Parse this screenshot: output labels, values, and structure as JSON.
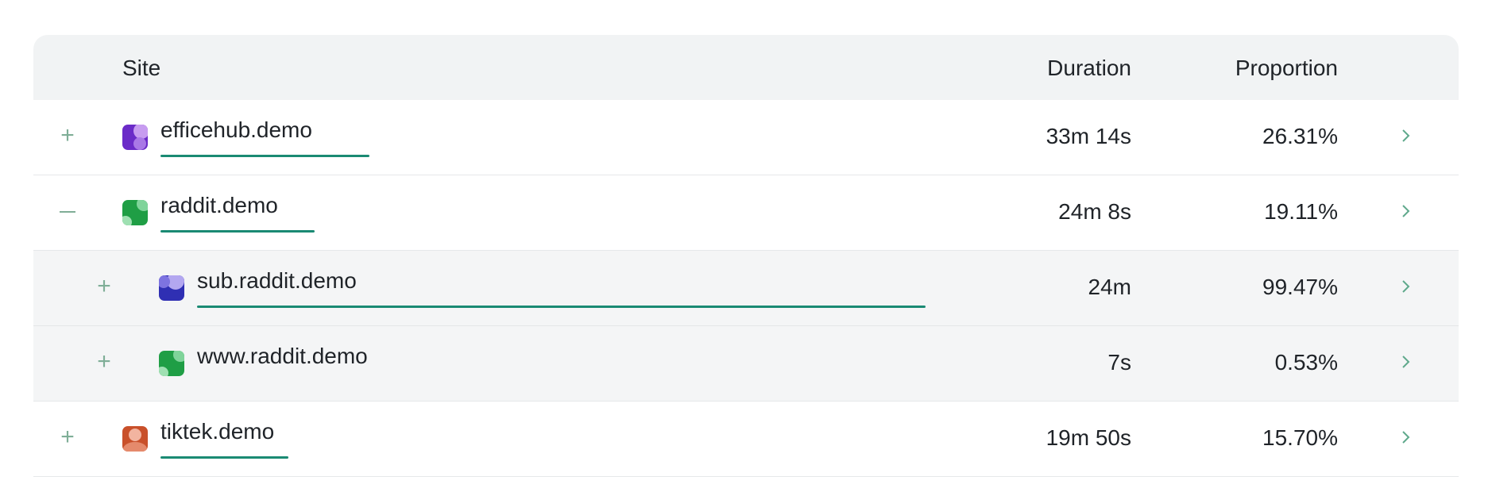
{
  "header": {
    "site": "Site",
    "duration": "Duration",
    "proportion": "Proportion"
  },
  "rows": [
    {
      "site": "efficehub.demo",
      "duration": "33m 14s",
      "proportion": "26.31%",
      "bar_fraction": 0.2631,
      "expanded": false,
      "icon": "efficehub-favicon",
      "icon_colors": [
        "#6b2bc8",
        "#c79cf0"
      ]
    },
    {
      "site": "raddit.demo",
      "duration": "24m 8s",
      "proportion": "19.11%",
      "bar_fraction": 0.1911,
      "expanded": true,
      "icon": "raddit-favicon",
      "icon_colors": [
        "#1f9e45",
        "#7fd49a"
      ]
    },
    {
      "site": "sub.raddit.demo",
      "duration": "24m",
      "proportion": "99.47%",
      "bar_fraction": 0.9947,
      "expanded": false,
      "icon": "sub-raddit-favicon",
      "icon_colors": [
        "#2f2fb3",
        "#b3a7f0"
      ]
    },
    {
      "site": "www.raddit.demo",
      "duration": "7s",
      "proportion": "0.53%",
      "bar_fraction": 0.0053,
      "expanded": false,
      "icon": "www-raddit-favicon",
      "icon_colors": [
        "#1f9e45",
        "#7fd49a"
      ]
    },
    {
      "site": "tiktek.demo",
      "duration": "19m 50s",
      "proportion": "15.70%",
      "bar_fraction": 0.157,
      "expanded": false,
      "icon": "tiktek-favicon",
      "icon_colors": [
        "#c9502a",
        "#f2b4a0"
      ]
    }
  ],
  "accent_color": "#1a8a73"
}
